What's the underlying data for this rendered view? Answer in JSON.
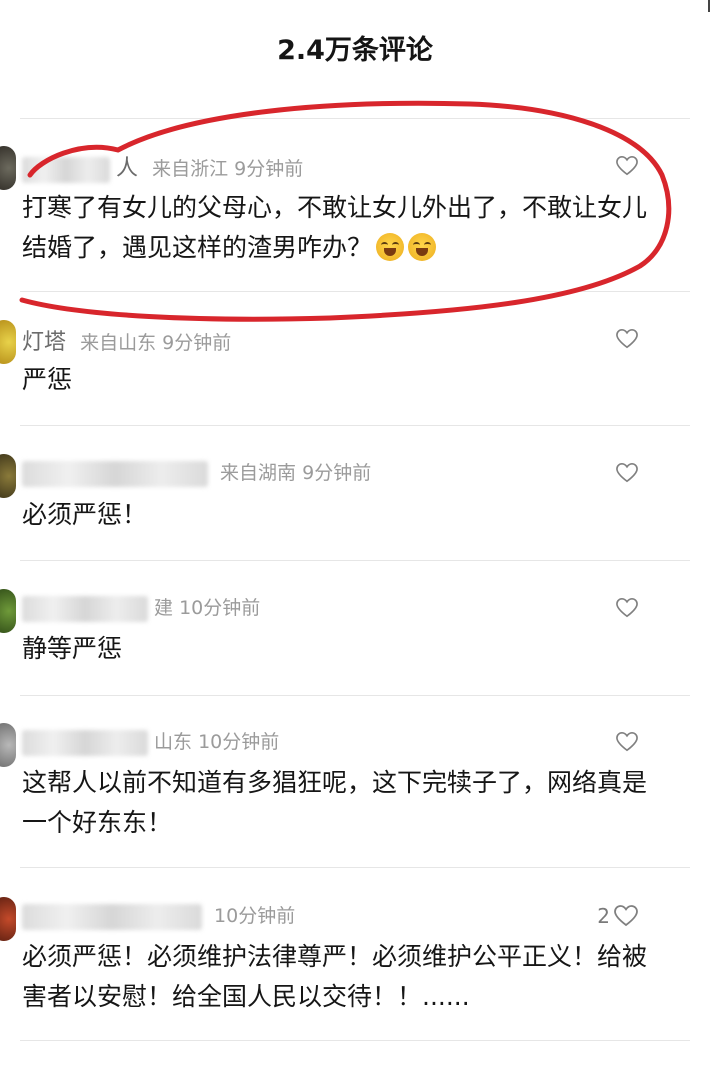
{
  "header": {
    "title": "2.4万条评论"
  },
  "comments": [
    {
      "name_visible": "人",
      "location": "来自浙江",
      "time": "9分钟前",
      "text": "打寒了有女儿的父母心，不敢让女儿外出了，不敢让女儿结婚了，遇见这样的渣男咋办？",
      "likes": "",
      "emoji": "laugh-cry-emoji",
      "circled": true
    },
    {
      "name_visible": "灯塔",
      "location": "来自山东",
      "time": "9分钟前",
      "text": "严惩",
      "likes": ""
    },
    {
      "name_visible": "",
      "location": "来自湖南",
      "time": "9分钟前",
      "text": "必须严惩！",
      "likes": ""
    },
    {
      "name_visible": "",
      "location": "建",
      "time": "10分钟前",
      "text": "静等严惩",
      "likes": ""
    },
    {
      "name_visible": "",
      "location": "山东",
      "time": "10分钟前",
      "text": "这帮人以前不知道有多猖狂呢，这下完犊子了，网络真是一个好东东！",
      "likes": ""
    },
    {
      "name_visible": "",
      "location": "",
      "time": "10分钟前",
      "text": "必须严惩！必须维护法律尊严！必须维护公平正义！给被害者以安慰！给全国人民以交待！！......",
      "likes": "2"
    }
  ],
  "colors": {
    "annotation_red": "#d8262c",
    "meta_gray": "#9b9b9b",
    "divider": "#e6e6e6"
  },
  "icons": {
    "like": "heart-outline-icon"
  }
}
